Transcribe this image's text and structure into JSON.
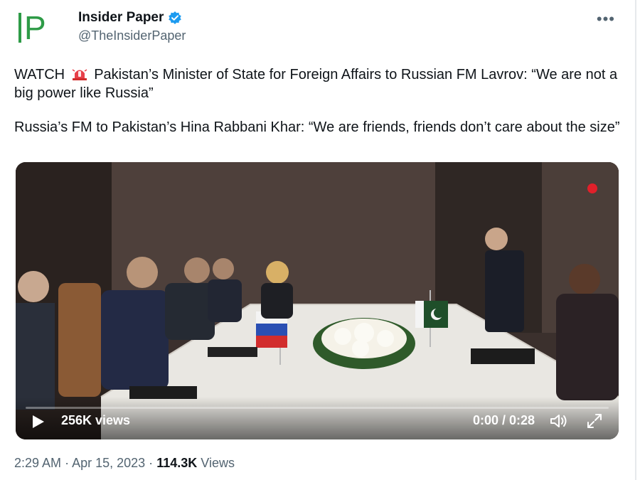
{
  "author": {
    "name": "Insider Paper",
    "handle": "@TheInsiderPaper",
    "avatar_letters": "IP",
    "verified": true
  },
  "more_icon": "more-horizontal-icon",
  "tweet": {
    "line1_prefix": "WATCH",
    "emoji": "siren-icon",
    "line1_rest": "Pakistan’s Minister of State for Foreign Affairs to Russian FM Lavrov: “We are not a big power like Russia”",
    "line2": "Russia’s FM to Pakistan’s Hina Rabbani Khar: “We are friends, friends don’t care about the size”"
  },
  "video": {
    "views": "256K views",
    "time": "0:00 / 0:28",
    "progress": 0.0,
    "icons": [
      "play-icon",
      "volume-icon",
      "fullscreen-icon"
    ]
  },
  "meta": {
    "time": "2:29 AM",
    "date": "Apr 15, 2023",
    "views_count": "114.3K",
    "views_label": "Views",
    "separator": "·"
  },
  "colors": {
    "brand_green": "#2e9b47",
    "verified_blue": "#1d9bf0",
    "text_secondary": "#536471"
  }
}
